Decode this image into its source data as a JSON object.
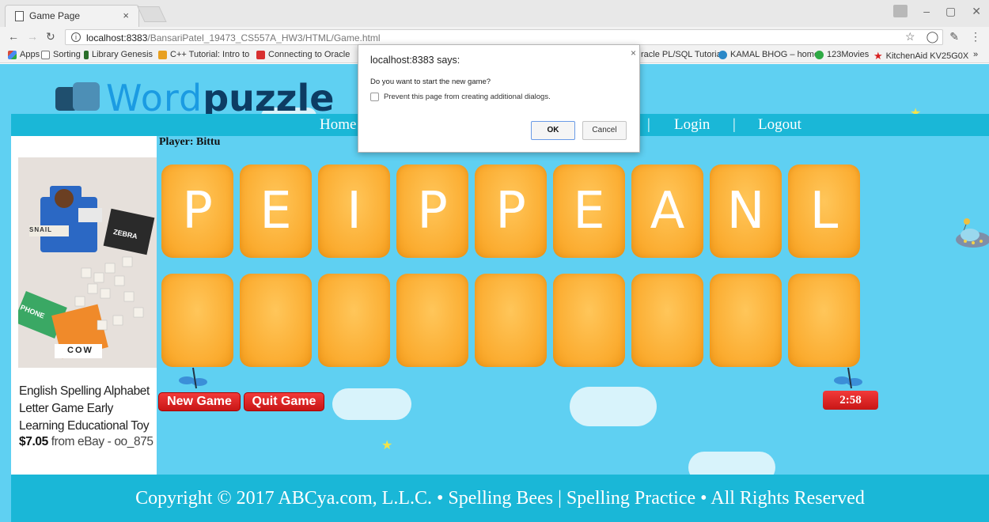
{
  "browser": {
    "tab_title": "Game Page",
    "tab_close": "×",
    "url_host": "localhost:8383",
    "url_path": "/BansariPatel_19473_CS557A_HW3/HTML/Game.html",
    "bookmarks": [
      {
        "label": "Apps",
        "color": "#d84a3a"
      },
      {
        "label": "Sorting",
        "color": "#888888"
      },
      {
        "label": "Library Genesis",
        "color": "#2a6f2a"
      },
      {
        "label": "C++ Tutorial: Intro to",
        "color": "#e8a020"
      },
      {
        "label": "Connecting to Oracle",
        "color": "#d83030"
      },
      {
        "label": "racle PL/SQL Tutoria",
        "color": "#999999"
      },
      {
        "label": "KAMAL BHOG – home",
        "color": "#2a88c8"
      },
      {
        "label": "123Movies",
        "color": "#2eaa44"
      },
      {
        "label": "KitchenAid KV25G0X",
        "color": "#d82020"
      }
    ],
    "more_bookmarks": "»"
  },
  "site": {
    "logo_word1": "Word",
    "logo_word2": "puzzle",
    "nav": {
      "home": "Home",
      "login": "Login",
      "logout": "Logout",
      "separator": "|"
    },
    "player_label": "Player: Bittu",
    "letters": [
      "P",
      "E",
      "I",
      "P",
      "P",
      "E",
      "A",
      "N",
      "L"
    ],
    "answer_slots": [
      "",
      "",
      "",
      "",
      "",
      "",
      "",
      "",
      ""
    ],
    "new_game_label": "New Game",
    "quit_game_label": "Quit Game",
    "timer": "2:58",
    "footer": "Copyright © 2017 ABCya.com, L.L.C. • Spelling Bees | Spelling Practice • All Rights Reserved"
  },
  "ad": {
    "title": "English Spelling Alphabet Letter Game Early Learning Educational Toy",
    "price": "$7.05",
    "seller": " from eBay - oo_875",
    "image_words": [
      "SNAIL",
      "ZEBRA",
      "PHONE",
      "COW"
    ]
  },
  "dialog": {
    "title": "localhost:8383 says:",
    "message": "Do you want to start the new game?",
    "checkbox_label": "Prevent this page from creating additional dialogs.",
    "ok_label": "OK",
    "cancel_label": "Cancel",
    "close": "×"
  }
}
